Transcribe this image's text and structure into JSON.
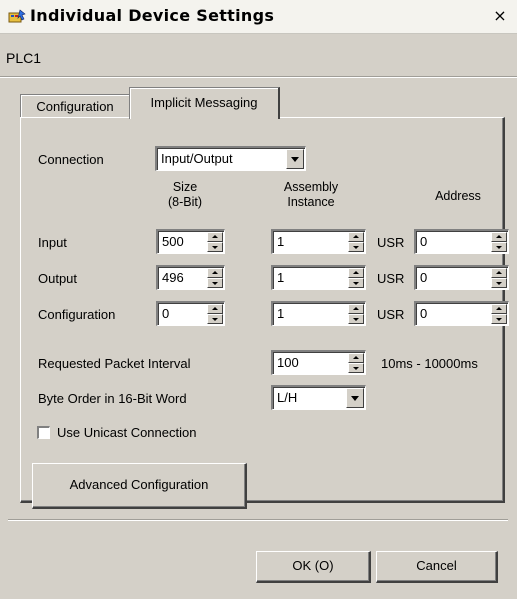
{
  "window": {
    "title": "Individual Device Settings",
    "close_label": "×",
    "icon": "app-icon"
  },
  "device_name": "PLC1",
  "tabs": [
    {
      "label": "Configuration",
      "selected": false
    },
    {
      "label": "Implicit Messaging",
      "selected": true
    }
  ],
  "connection": {
    "label": "Connection",
    "value": "Input/Output"
  },
  "headers": {
    "size": "Size",
    "size_sub": "(8-Bit)",
    "assembly": "Assembly",
    "assembly_sub": "Instance",
    "address": "Address"
  },
  "rows": [
    {
      "label": "Input",
      "size": "500",
      "instance": "1",
      "prefix": "USR",
      "address": "0"
    },
    {
      "label": "Output",
      "size": "496",
      "instance": "1",
      "prefix": "USR",
      "address": "0"
    },
    {
      "label": "Configuration",
      "size": "0",
      "instance": "1",
      "prefix": "USR",
      "address": "0"
    }
  ],
  "rpi": {
    "label": "Requested Packet Interval",
    "value": "100",
    "range": "10ms - 10000ms"
  },
  "byte_order": {
    "label": "Byte Order in 16-Bit Word",
    "value": "L/H"
  },
  "unicast": {
    "label": "Use Unicast Connection",
    "checked": false
  },
  "advanced_button": "Advanced Configuration",
  "footer": {
    "ok": "OK (O)",
    "cancel": "Cancel"
  }
}
